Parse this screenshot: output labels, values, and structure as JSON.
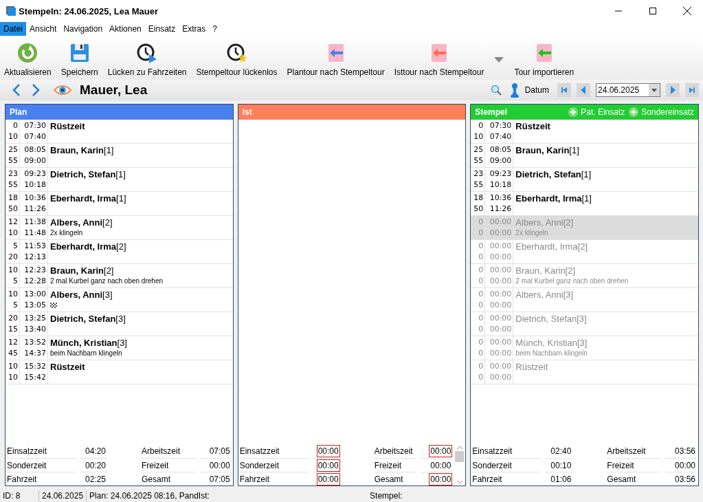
{
  "window": {
    "title": "Stempeln: 24.06.2025, Lea Mauer"
  },
  "menu": [
    {
      "label": "Datei",
      "selected": true
    },
    {
      "label": "Ansicht",
      "selected": false
    },
    {
      "label": "Navigation",
      "selected": false
    },
    {
      "label": "Aktionen",
      "selected": false
    },
    {
      "label": "Einsatz",
      "selected": false
    },
    {
      "label": "Extras",
      "selected": false
    },
    {
      "label": "?",
      "selected": false
    }
  ],
  "toolbar": [
    {
      "kind": "refresh",
      "label": "Aktualisieren"
    },
    {
      "kind": "save",
      "label": "Speichern"
    },
    {
      "kind": "gaps",
      "label": "Lücken zu Fahrzeiten"
    },
    {
      "kind": "gapless",
      "label": "Stempeltour lückenlos"
    },
    {
      "kind": "plan",
      "label": "Plantour nach Stempeltour"
    },
    {
      "kind": "ist",
      "label": "Isttour nach Stempeltour"
    },
    {
      "kind": "dropdown"
    },
    {
      "kind": "import",
      "label": "Tour importieren"
    }
  ],
  "nav": {
    "name": "Mauer, Lea",
    "date_label": "Datum",
    "date": "24.06.2025"
  },
  "panels": [
    {
      "title": "Plan",
      "color": "#4a80f0",
      "scrollbar": false,
      "rows": [
        {
          "d1": "0",
          "t1": "07:30",
          "d2": "10",
          "t2": "07:40",
          "name": "Rüstzeit",
          "flag": false,
          "stamped": true,
          "selected": false
        },
        {
          "d1": "25",
          "t1": "08:05",
          "d2": "55",
          "t2": "09:00",
          "name": "Braun, Karin",
          "index": "[1]",
          "flag": false,
          "stamped": true,
          "selected": false
        },
        {
          "d1": "23",
          "t1": "09:23",
          "d2": "55",
          "t2": "10:18",
          "name": "Dietrich, Stefan",
          "index": "[1]",
          "flag": false,
          "stamped": true,
          "selected": false
        },
        {
          "d1": "18",
          "t1": "10:36",
          "d2": "50",
          "t2": "11:26",
          "name": "Eberhardt, Irma",
          "index": "[1]",
          "flag": false,
          "stamped": true,
          "selected": false
        },
        {
          "d1": "12",
          "t1": "11:38",
          "d2": "10",
          "t2": "11:48",
          "name": "Albers, Anni",
          "index": "[2]",
          "note": "2x klingeln",
          "flag": false,
          "stamped": true,
          "selected": false
        },
        {
          "d1": "5",
          "t1": "11:53",
          "d2": "20",
          "t2": "12:13",
          "name": "Eberhardt, Irma",
          "index": "[2]",
          "flag": false,
          "stamped": true,
          "selected": false
        },
        {
          "d1": "10",
          "t1": "12:23",
          "d2": "5",
          "t2": "12:28",
          "name": "Braun, Karin",
          "index": "[2]",
          "note": "2 mal Kurbel ganz nach oben drehen",
          "flag": false,
          "stamped": true,
          "selected": false
        },
        {
          "d1": "10",
          "t1": "13:00",
          "d2": "5",
          "t2": "13:05",
          "name": "Albers, Anni",
          "index": "[3]",
          "flag": true,
          "stamped": true,
          "selected": false
        },
        {
          "d1": "20",
          "t1": "13:25",
          "d2": "15",
          "t2": "13:40",
          "name": "Dietrich, Stefan",
          "index": "[3]",
          "flag": false,
          "stamped": true,
          "selected": false
        },
        {
          "d1": "12",
          "t1": "13:52",
          "d2": "45",
          "t2": "14:37",
          "name": "Münch, Kristian",
          "index": "[3]",
          "note": "beim Nachbarn klingeln",
          "flag": false,
          "stamped": true,
          "selected": false
        },
        {
          "d1": "10",
          "t1": "15:32",
          "d2": "10",
          "t2": "15:42",
          "name": "Rüstzeit",
          "flag": false,
          "stamped": true,
          "selected": false
        }
      ],
      "summary": [
        {
          "label": "Einsatzzeit",
          "value": "04:20",
          "flagged": false
        },
        {
          "label": "Arbeitszeit",
          "value": "07:05",
          "flagged": false
        },
        {
          "label": "Sonderzeit",
          "value": "00:20",
          "flagged": false
        },
        {
          "label": "Freizeit",
          "value": "00:00",
          "flagged": false
        },
        {
          "label": "Fahrzeit",
          "value": "02:25",
          "flagged": false
        },
        {
          "label": "Gesamt",
          "value": "07:05",
          "flagged": false
        }
      ]
    },
    {
      "title": "Ist",
      "color": "#ff7f5a",
      "scrollbar": true,
      "summary": [
        {
          "label": "Einsatzzeit",
          "value": "00:00",
          "flagged": true
        },
        {
          "label": "Arbeitszeit",
          "value": "00:00",
          "flagged": true
        },
        {
          "label": "Sonderzeit",
          "value": "00:00",
          "flagged": true
        },
        {
          "label": "Freizeit",
          "value": "00:00",
          "flagged": false
        },
        {
          "label": "Fahrzeit",
          "value": "00:00",
          "flagged": true
        },
        {
          "label": "Gesamt",
          "value": "00:00",
          "flagged": true
        }
      ]
    },
    {
      "title": "Stempel",
      "color": "#22cc33",
      "scrollbar": false,
      "actions": [
        "Pat. Einsatz",
        "Sondereinsatz"
      ],
      "rows": [
        {
          "d1": "0",
          "t1": "07:30",
          "d2": "10",
          "t2": "07:40",
          "name": "Rüstzeit",
          "flag": false,
          "stamped": true,
          "selected": false
        },
        {
          "d1": "25",
          "t1": "08:05",
          "d2": "55",
          "t2": "09:00",
          "name": "Braun, Karin",
          "index": "[1]",
          "flag": false,
          "stamped": true,
          "selected": false
        },
        {
          "d1": "23",
          "t1": "09:23",
          "d2": "55",
          "t2": "10:18",
          "name": "Dietrich, Stefan",
          "index": "[1]",
          "flag": false,
          "stamped": true,
          "selected": false
        },
        {
          "d1": "18",
          "t1": "10:36",
          "d2": "50",
          "t2": "11:26",
          "name": "Eberhardt, Irma",
          "index": "[1]",
          "flag": false,
          "stamped": true,
          "selected": false
        },
        {
          "d1": "0",
          "t1": "00:00",
          "d2": "0",
          "t2": "00:00",
          "name": "Albers, Anni",
          "index": "[2]",
          "note": "2x klingeln",
          "flag": false,
          "stamped": false,
          "selected": true
        },
        {
          "d1": "0",
          "t1": "00:00",
          "d2": "0",
          "t2": "00:00",
          "name": "Eberhardt, Irma",
          "index": "[2]",
          "flag": false,
          "stamped": false,
          "selected": false
        },
        {
          "d1": "0",
          "t1": "00:00",
          "d2": "0",
          "t2": "00:00",
          "name": "Braun, Karin",
          "index": "[2]",
          "note": "2 mal Kurbel ganz nach oben drehen",
          "flag": false,
          "stamped": false,
          "selected": false
        },
        {
          "d1": "0",
          "t1": "00:00",
          "d2": "0",
          "t2": "00:00",
          "name": "Albers, Anni",
          "index": "[3]",
          "flag": false,
          "stamped": false,
          "selected": false
        },
        {
          "d1": "0",
          "t1": "00:00",
          "d2": "0",
          "t2": "00:00",
          "name": "Dietrich, Stefan",
          "index": "[3]",
          "flag": false,
          "stamped": false,
          "selected": false
        },
        {
          "d1": "0",
          "t1": "00:00",
          "d2": "0",
          "t2": "00:00",
          "name": "Münch, Kristian",
          "index": "[3]",
          "note": "beim Nachbarn klingeln",
          "flag": false,
          "stamped": false,
          "selected": false
        },
        {
          "d1": "0",
          "t1": "00:00",
          "d2": "0",
          "t2": "00:00",
          "name": "Rüstzeit",
          "flag": false,
          "stamped": false,
          "selected": false
        }
      ],
      "summary": [
        {
          "label": "Einsatzzeit",
          "value": "02:40",
          "flagged": false
        },
        {
          "label": "Arbeitszeit",
          "value": "03:56",
          "flagged": false
        },
        {
          "label": "Sonderzeit",
          "value": "00:10",
          "flagged": false
        },
        {
          "label": "Freizeit",
          "value": "00:00",
          "flagged": false
        },
        {
          "label": "Fahrzeit",
          "value": "01:06",
          "flagged": false
        },
        {
          "label": "Gesamt",
          "value": "03:56",
          "flagged": false
        }
      ]
    }
  ],
  "status_bar": [
    "ID: 8",
    "24.06.2025",
    "Plan: 24.06.2025 08:16, PandIst:",
    "Stempel:"
  ]
}
